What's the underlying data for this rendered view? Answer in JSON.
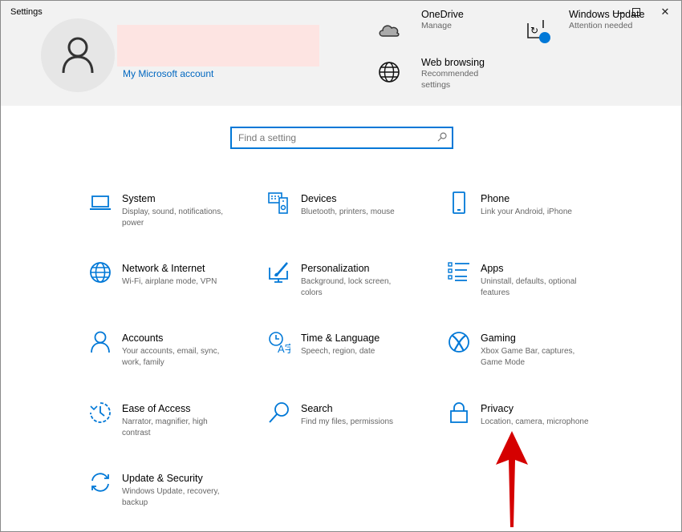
{
  "window": {
    "title": "Settings",
    "controls": [
      "minimize",
      "maximize",
      "close"
    ]
  },
  "account": {
    "link": "My Microsoft account"
  },
  "header_items": [
    {
      "title": "OneDrive",
      "subtitle": "Manage",
      "icon": "cloud-icon"
    },
    {
      "title": "Windows Update",
      "subtitle": "Attention needed",
      "icon": "update-icon"
    },
    {
      "title": "Web browsing",
      "subtitle": "Recommended settings",
      "icon": "globe-icon"
    }
  ],
  "search": {
    "placeholder": "Find a setting",
    "value": ""
  },
  "accent": "#0078d7",
  "annotation_color": "#d50000",
  "categories": [
    {
      "title": "System",
      "subtitle": "Display, sound, notifications, power",
      "icon": "laptop-icon"
    },
    {
      "title": "Devices",
      "subtitle": "Bluetooth, printers, mouse",
      "icon": "devices-icon"
    },
    {
      "title": "Phone",
      "subtitle": "Link your Android, iPhone",
      "icon": "phone-icon"
    },
    {
      "title": "Network & Internet",
      "subtitle": "Wi-Fi, airplane mode, VPN",
      "icon": "globe-icon"
    },
    {
      "title": "Personalization",
      "subtitle": "Background, lock screen, colors",
      "icon": "paint-icon"
    },
    {
      "title": "Apps",
      "subtitle": "Uninstall, defaults, optional features",
      "icon": "apps-list-icon"
    },
    {
      "title": "Accounts",
      "subtitle": "Your accounts, email, sync, work, family",
      "icon": "person-icon"
    },
    {
      "title": "Time & Language",
      "subtitle": "Speech, region, date",
      "icon": "time-language-icon"
    },
    {
      "title": "Gaming",
      "subtitle": "Xbox Game Bar, captures, Game Mode",
      "icon": "xbox-icon"
    },
    {
      "title": "Ease of Access",
      "subtitle": "Narrator, magnifier, high contrast",
      "icon": "ease-of-access-icon"
    },
    {
      "title": "Search",
      "subtitle": "Find my files, permissions",
      "icon": "search-icon"
    },
    {
      "title": "Privacy",
      "subtitle": "Location, camera, microphone",
      "icon": "lock-icon"
    },
    {
      "title": "Update & Security",
      "subtitle": "Windows Update, recovery, backup",
      "icon": "sync-icon"
    }
  ]
}
